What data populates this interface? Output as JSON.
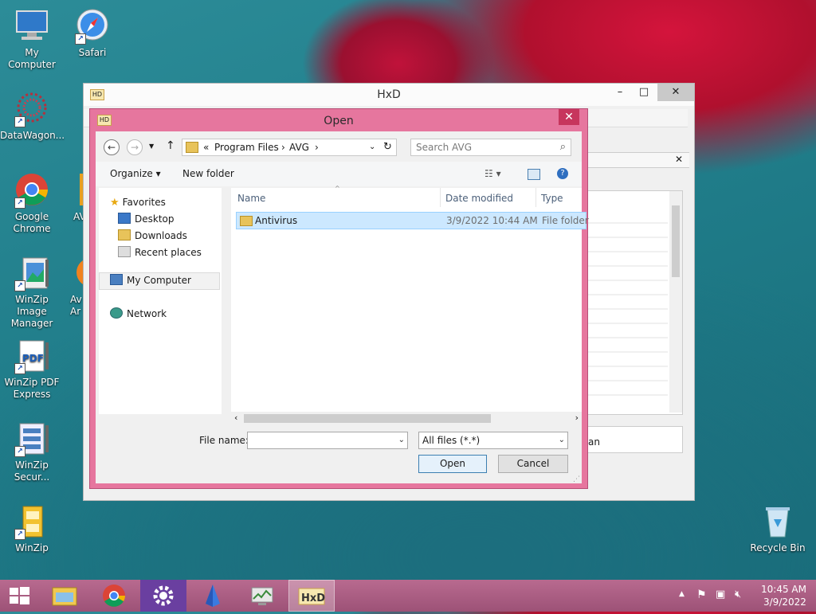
{
  "desktop": {
    "icons": [
      {
        "label": "My Computer"
      },
      {
        "label": "Safari"
      },
      {
        "label": "DataWagon..."
      },
      {
        "label": "Google Chrome"
      },
      {
        "label": "AVG"
      },
      {
        "label": "WinZip Image Manager"
      },
      {
        "label": "Av Ar"
      },
      {
        "label": "WinZip PDF Express"
      },
      {
        "label": "WinZip Secur..."
      },
      {
        "label": "WinZip"
      },
      {
        "label": "Recycle Bin"
      }
    ]
  },
  "hxd": {
    "title": "HxD",
    "minimize": "–",
    "maximize": "□",
    "close": "✕",
    "inner_close": "✕",
    "partial_text": "an"
  },
  "dialog": {
    "title": "Open",
    "close": "✕",
    "address": {
      "prefix": "«",
      "crumbs": [
        "Program Files",
        "AVG"
      ],
      "sep": "›"
    },
    "search_placeholder": "Search AVG",
    "toolbar": {
      "organize": "Organize ▾",
      "new_folder": "New folder"
    },
    "nav": {
      "favorites": "Favorites",
      "desktop": "Desktop",
      "downloads": "Downloads",
      "recent": "Recent places",
      "computer": "My Computer",
      "network": "Network"
    },
    "columns": {
      "name": "Name",
      "date": "Date modified",
      "type": "Type"
    },
    "files": [
      {
        "name": "Antivirus",
        "date": "3/9/2022 10:44 AM",
        "type": "File folder"
      }
    ],
    "file_name_label": "File name:",
    "file_name_value": "",
    "filter": "All files (*.*)",
    "open_btn": "Open",
    "cancel_btn": "Cancel"
  },
  "taskbar": {
    "time": "10:45 AM",
    "date": "3/9/2022",
    "tray_arrow": "▲"
  }
}
